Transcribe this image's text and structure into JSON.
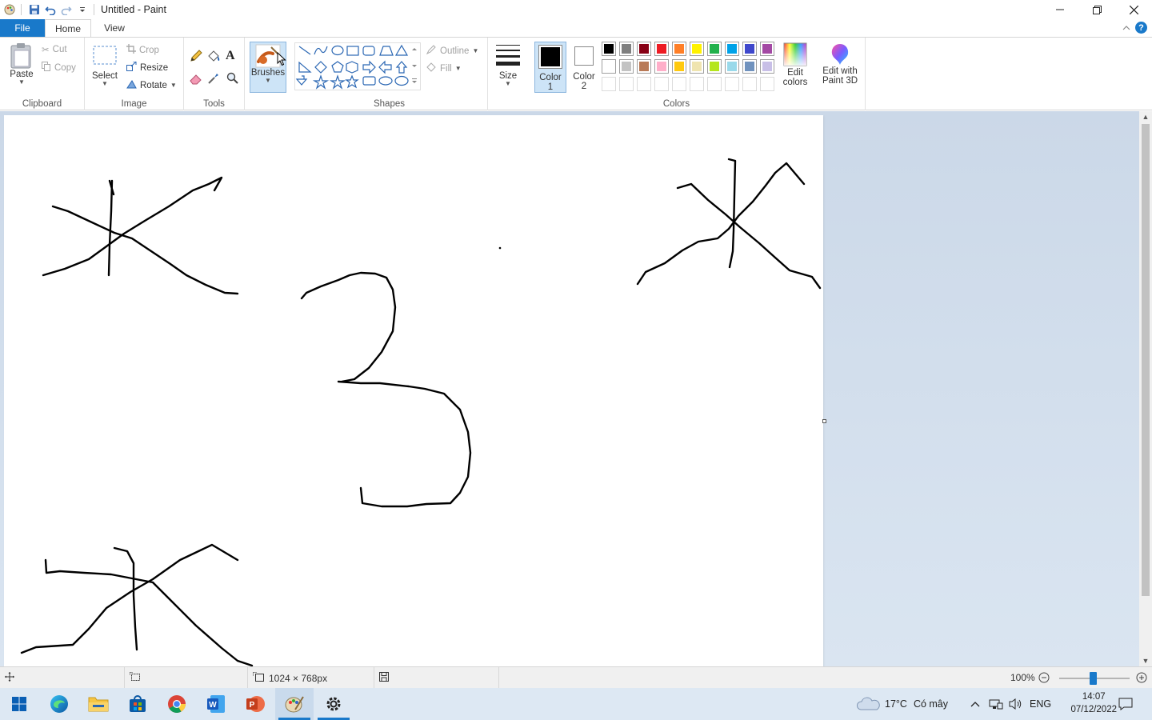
{
  "window": {
    "title": "Untitled - Paint"
  },
  "tabs": {
    "file": "File",
    "home": "Home",
    "view": "View"
  },
  "clipboard": {
    "paste": "Paste",
    "cut": "Cut",
    "copy": "Copy",
    "group_label": "Clipboard"
  },
  "image": {
    "select": "Select",
    "crop": "Crop",
    "resize": "Resize",
    "rotate": "Rotate",
    "group_label": "Image"
  },
  "tools": {
    "group_label": "Tools"
  },
  "brushes": {
    "label": "Brushes"
  },
  "shapes": {
    "outline": "Outline",
    "fill": "Fill",
    "group_label": "Shapes"
  },
  "size": {
    "label": "Size"
  },
  "color1": {
    "label": "Color",
    "num": "1",
    "value": "#000000"
  },
  "color2": {
    "label": "Color",
    "num": "2",
    "value": "#ffffff"
  },
  "colors": {
    "group_label": "Colors",
    "row1": [
      "#000000",
      "#7f7f7f",
      "#880015",
      "#ed1c24",
      "#ff7f27",
      "#fff200",
      "#22b14c",
      "#00a2e8",
      "#3f48cc",
      "#a349a4"
    ],
    "row2": [
      "#ffffff",
      "#c3c3c3",
      "#b97a57",
      "#ffaec9",
      "#ffc90e",
      "#efe4b0",
      "#b5e61d",
      "#99d9ea",
      "#7092be",
      "#c8bfe7"
    ],
    "edit": "Edit colors"
  },
  "paint3d": {
    "label_line1": "Edit with",
    "label_line2": "Paint 3D"
  },
  "status": {
    "dimensions": "1024 × 768px",
    "zoom": "100%"
  },
  "taskbar": {
    "weather": "17°C",
    "weather_desc": "Có mây",
    "lang": "ENG",
    "time": "14:07",
    "date": "07/12/2022"
  }
}
